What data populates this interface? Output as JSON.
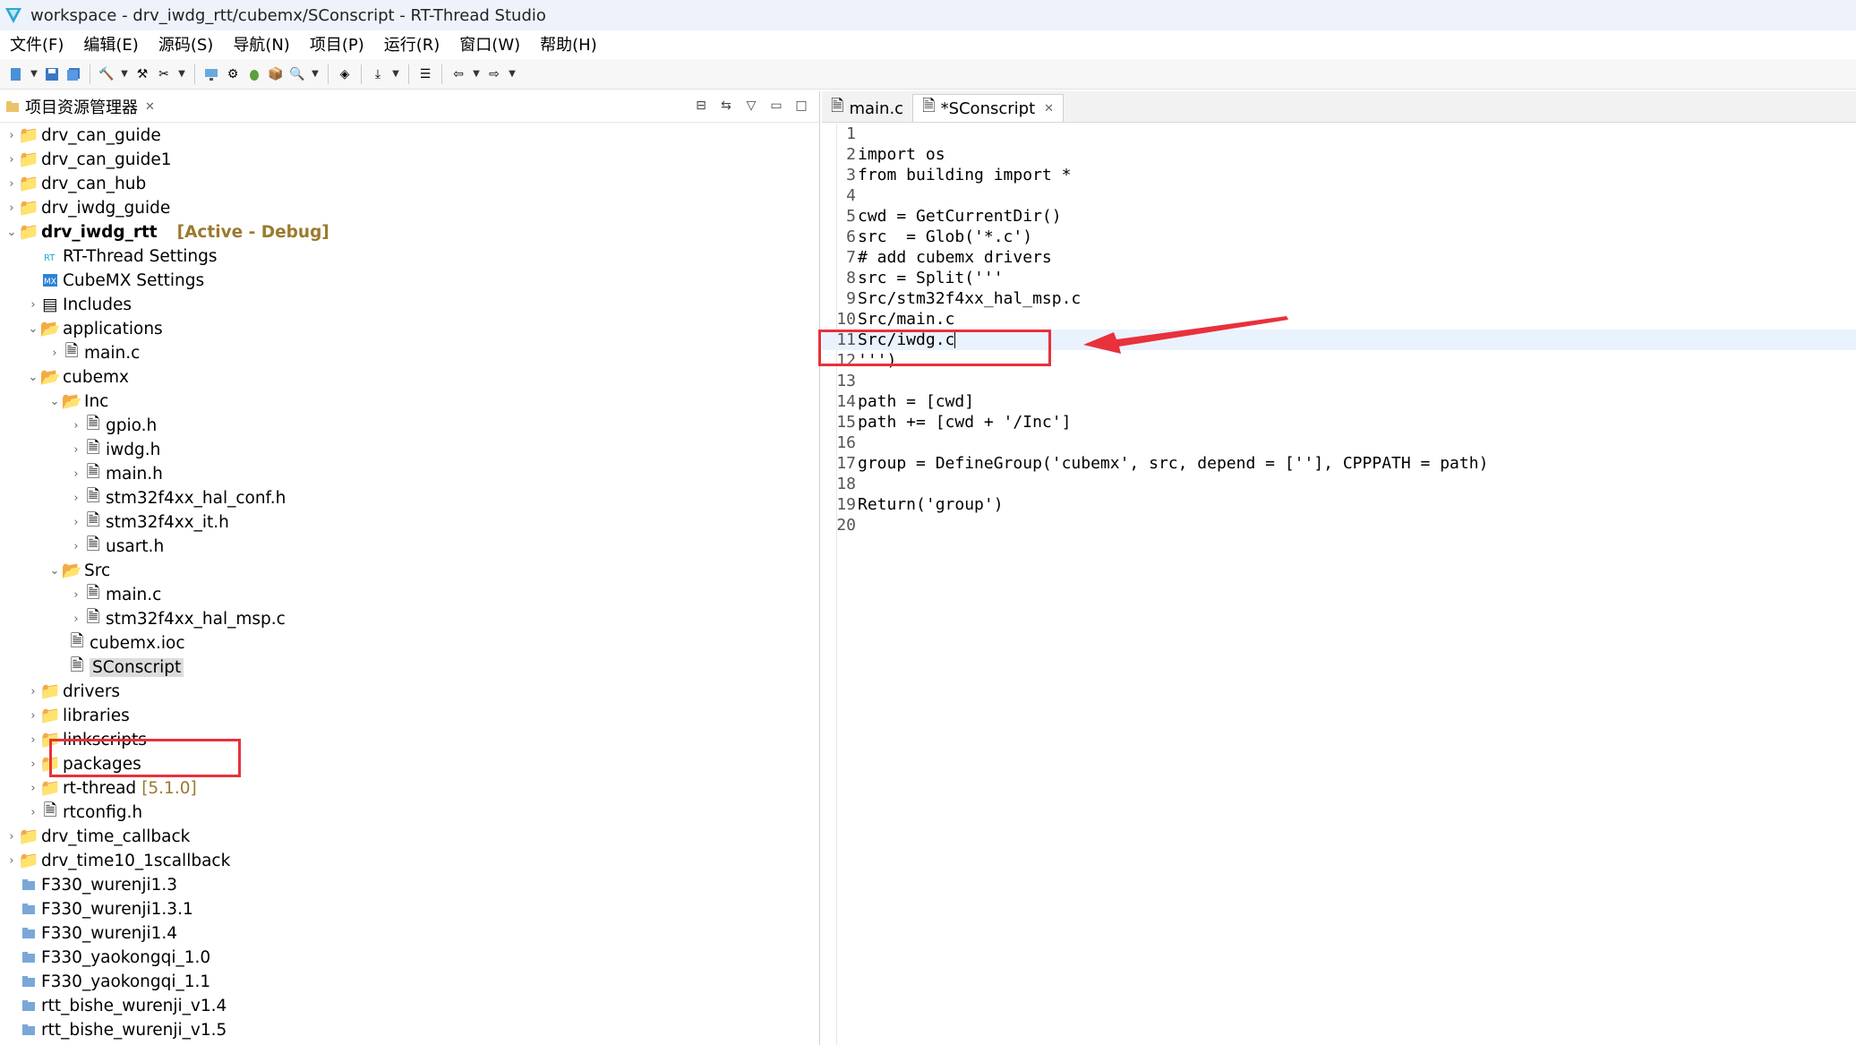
{
  "window": {
    "title": "workspace - drv_iwdg_rtt/cubemx/SConscript - RT-Thread Studio"
  },
  "menu": [
    "文件(F)",
    "编辑(E)",
    "源码(S)",
    "导航(N)",
    "项目(P)",
    "运行(R)",
    "窗口(W)",
    "帮助(H)"
  ],
  "explorer": {
    "title": "项目资源管理器",
    "rows": [
      {
        "label": "drv_can_guide"
      },
      {
        "label": "drv_can_guide1"
      },
      {
        "label": "drv_can_hub"
      },
      {
        "label": "drv_iwdg_guide"
      },
      {
        "label": "drv_iwdg_rtt",
        "extra": "[Active - Debug]"
      },
      {
        "label": "RT-Thread Settings"
      },
      {
        "label": "CubeMX Settings"
      },
      {
        "label": "Includes"
      },
      {
        "label": "applications"
      },
      {
        "label": "main.c"
      },
      {
        "label": "cubemx"
      },
      {
        "label": "Inc"
      },
      {
        "label": "gpio.h"
      },
      {
        "label": "iwdg.h"
      },
      {
        "label": "main.h"
      },
      {
        "label": "stm32f4xx_hal_conf.h"
      },
      {
        "label": "stm32f4xx_it.h"
      },
      {
        "label": "usart.h"
      },
      {
        "label": "Src"
      },
      {
        "label": "main.c"
      },
      {
        "label": "stm32f4xx_hal_msp.c"
      },
      {
        "label": "cubemx.ioc"
      },
      {
        "label": "SConscript"
      },
      {
        "label": "drivers"
      },
      {
        "label": "libraries"
      },
      {
        "label": "linkscripts"
      },
      {
        "label": "packages"
      },
      {
        "label": "rt-thread",
        "extra": "[5.1.0]"
      },
      {
        "label": "rtconfig.h"
      },
      {
        "label": "drv_time_callback"
      },
      {
        "label": "drv_time10_1scallback"
      },
      {
        "label": "F330_wurenji1.3"
      },
      {
        "label": "F330_wurenji1.3.1"
      },
      {
        "label": "F330_wurenji1.4"
      },
      {
        "label": "F330_yaokongqi_1.0"
      },
      {
        "label": "F330_yaokongqi_1.1"
      },
      {
        "label": "rtt_bishe_wurenji_v1.4"
      },
      {
        "label": "rtt_bishe_wurenji_v1.5"
      }
    ]
  },
  "editor": {
    "tabs": [
      {
        "label": "main.c"
      },
      {
        "label": "*SConscript"
      }
    ],
    "lines": [
      {
        "n": "1",
        "text": ""
      },
      {
        "n": "2",
        "text": "import os"
      },
      {
        "n": "3",
        "text": "from building import *"
      },
      {
        "n": "4",
        "text": ""
      },
      {
        "n": "5",
        "text": "cwd = GetCurrentDir()"
      },
      {
        "n": "6",
        "text": "src  = Glob('*.c')"
      },
      {
        "n": "7",
        "text": "# add cubemx drivers"
      },
      {
        "n": "8",
        "text": "src = Split('''"
      },
      {
        "n": "9",
        "text": "Src/stm32f4xx_hal_msp.c"
      },
      {
        "n": "10",
        "text": "Src/main.c"
      },
      {
        "n": "11",
        "text": "Src/iwdg.c"
      },
      {
        "n": "12",
        "text": "''')"
      },
      {
        "n": "13",
        "text": ""
      },
      {
        "n": "14",
        "text": "path = [cwd]"
      },
      {
        "n": "15",
        "text": "path += [cwd + '/Inc']"
      },
      {
        "n": "16",
        "text": ""
      },
      {
        "n": "17",
        "text": "group = DefineGroup('cubemx', src, depend = [''], CPPPATH = path)"
      },
      {
        "n": "18",
        "text": ""
      },
      {
        "n": "19",
        "text": "Return('group')"
      },
      {
        "n": "20",
        "text": ""
      }
    ]
  },
  "colors": {
    "annotation_red": "#e8313b",
    "active_label": "#9a7a2e",
    "current_line": "#eaf2fd"
  }
}
